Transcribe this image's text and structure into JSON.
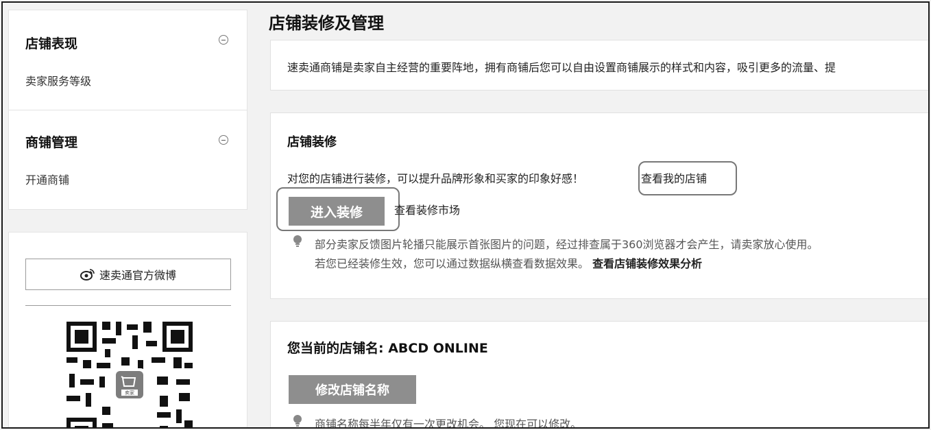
{
  "sidebar": {
    "sections": [
      {
        "title": "店铺表现",
        "item": "卖家服务等级"
      },
      {
        "title": "商铺管理",
        "item": "开通商铺"
      }
    ],
    "weibo_button": "速卖通官方微博",
    "qr_badge": "卖家"
  },
  "main": {
    "page_title": "店铺装修及管理",
    "intro": "速卖通商铺是卖家自主经营的重要阵地，拥有商铺后您可以自由设置商铺展示的样式和内容，吸引更多的流量、提",
    "decoration": {
      "heading": "店铺装修",
      "description": "对您的店铺进行装修，可以提升品牌形象和买家的印象好感！",
      "view_store_link": "查看我的店铺",
      "enter_button": "进入装修",
      "market_link": "查看装修市场",
      "tip_line1": "部分卖家反馈图片轮播只能展示首张图片的问题，经过排查属于360浏览器才会产生，请卖家放心使用。",
      "tip_line2": "若您已经装修生效，您可以通过数据纵横查看数据效果。",
      "tip_link": "查看店铺装修效果分析"
    },
    "store_name": {
      "heading": "您当前的店铺名: ABCD ONLINE",
      "rename_button": "修改店铺名称",
      "tip": "商铺名称每半年仅有一次更改机会。 您现在可以修改。"
    }
  },
  "colors": {
    "button_grey": "#8e8e8e",
    "background": "#f2f2f2",
    "panel": "#ffffff"
  }
}
